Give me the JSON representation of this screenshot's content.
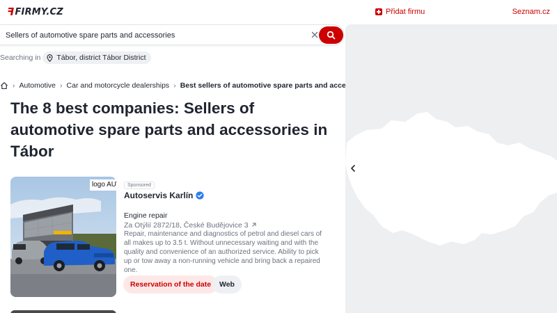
{
  "header": {
    "logo_text": "FIRMY.CZ",
    "add_firm_label": "Přidat firmu",
    "seznam_label": "Seznam.cz",
    "accent_color": "#cc0000"
  },
  "search": {
    "value": "Sellers of automotive spare parts and accessories",
    "searching_in_label": "Searching in",
    "location": "Tábor, district Tábor District"
  },
  "breadcrumb": {
    "items": [
      "Automotive",
      "Car and motorcycle dealerships"
    ],
    "current": "Best sellers of automotive spare parts and access..."
  },
  "page_title": "The 8 best companies: Sellers of automotive spare parts and accessories in Tábor",
  "results": [
    {
      "image_alt": "logo AUTOSERVIS KARLÍN",
      "sponsored_label": "Sponsored",
      "name": "Autoservis Karlín",
      "verified": true,
      "category": "Engine repair",
      "address": "Za Otýlií 2872/18, České Budějovice 3",
      "description": "Repair, maintenance and diagnostics of petrol and diesel cars of all makes up to 3.5 t. Without unnecessary waiting and with the quality and convenience of an authorized service. Ability to pick up or tow away a non-running vehicle and bring back a repaired one.",
      "reserve_label": "Reservation of the date",
      "web_label": "Web"
    }
  ],
  "icons": {
    "logo": "firmy-logo-icon",
    "add": "plus-square-icon",
    "clear": "close-icon",
    "search": "search-icon",
    "location": "map-pin-icon",
    "home": "home-icon",
    "chevron": "chevron-right-icon",
    "verified": "verified-badge-icon",
    "external": "external-link-icon",
    "collapse": "chevron-left-icon"
  }
}
